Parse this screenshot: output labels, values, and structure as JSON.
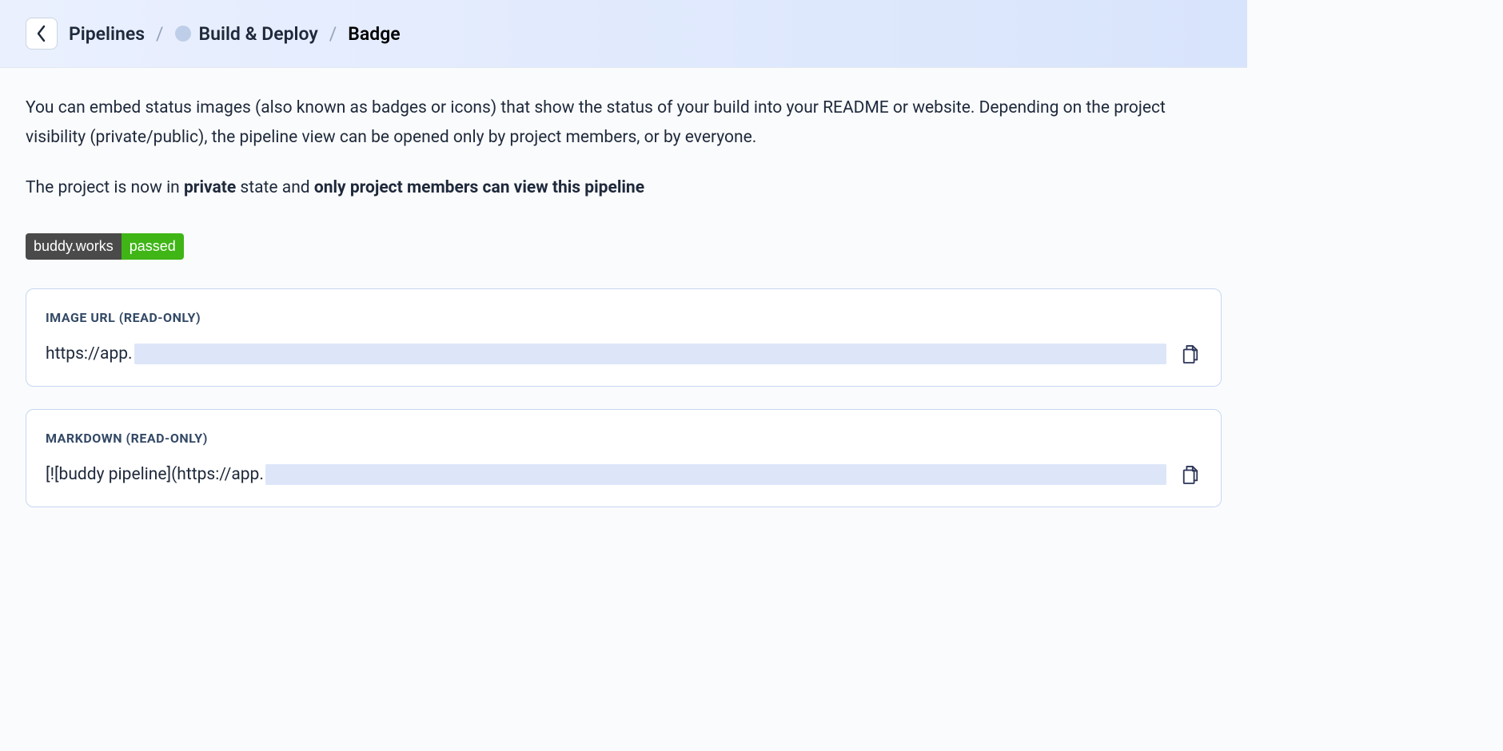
{
  "breadcrumb": {
    "pipelines": "Pipelines",
    "pipeline_name": "Build & Deploy",
    "current": "Badge"
  },
  "description": "You can embed status images (also known as badges or icons) that show the status of your build into your README or website. Depending on the project visibility (private/public), the pipeline view can be opened only by project members, or by everyone.",
  "visibility": {
    "prefix": "The project is now in ",
    "state": "private",
    "middle": " state and ",
    "who": "only project members can view this pipeline"
  },
  "badge": {
    "left": "buddy.works",
    "right": "passed"
  },
  "fields": {
    "image_url": {
      "label": "IMAGE URL (READ-ONLY)",
      "value_prefix": "https://app."
    },
    "markdown": {
      "label": "MARKDOWN (READ-ONLY)",
      "value_prefix": "[![buddy pipeline](https://app."
    }
  }
}
